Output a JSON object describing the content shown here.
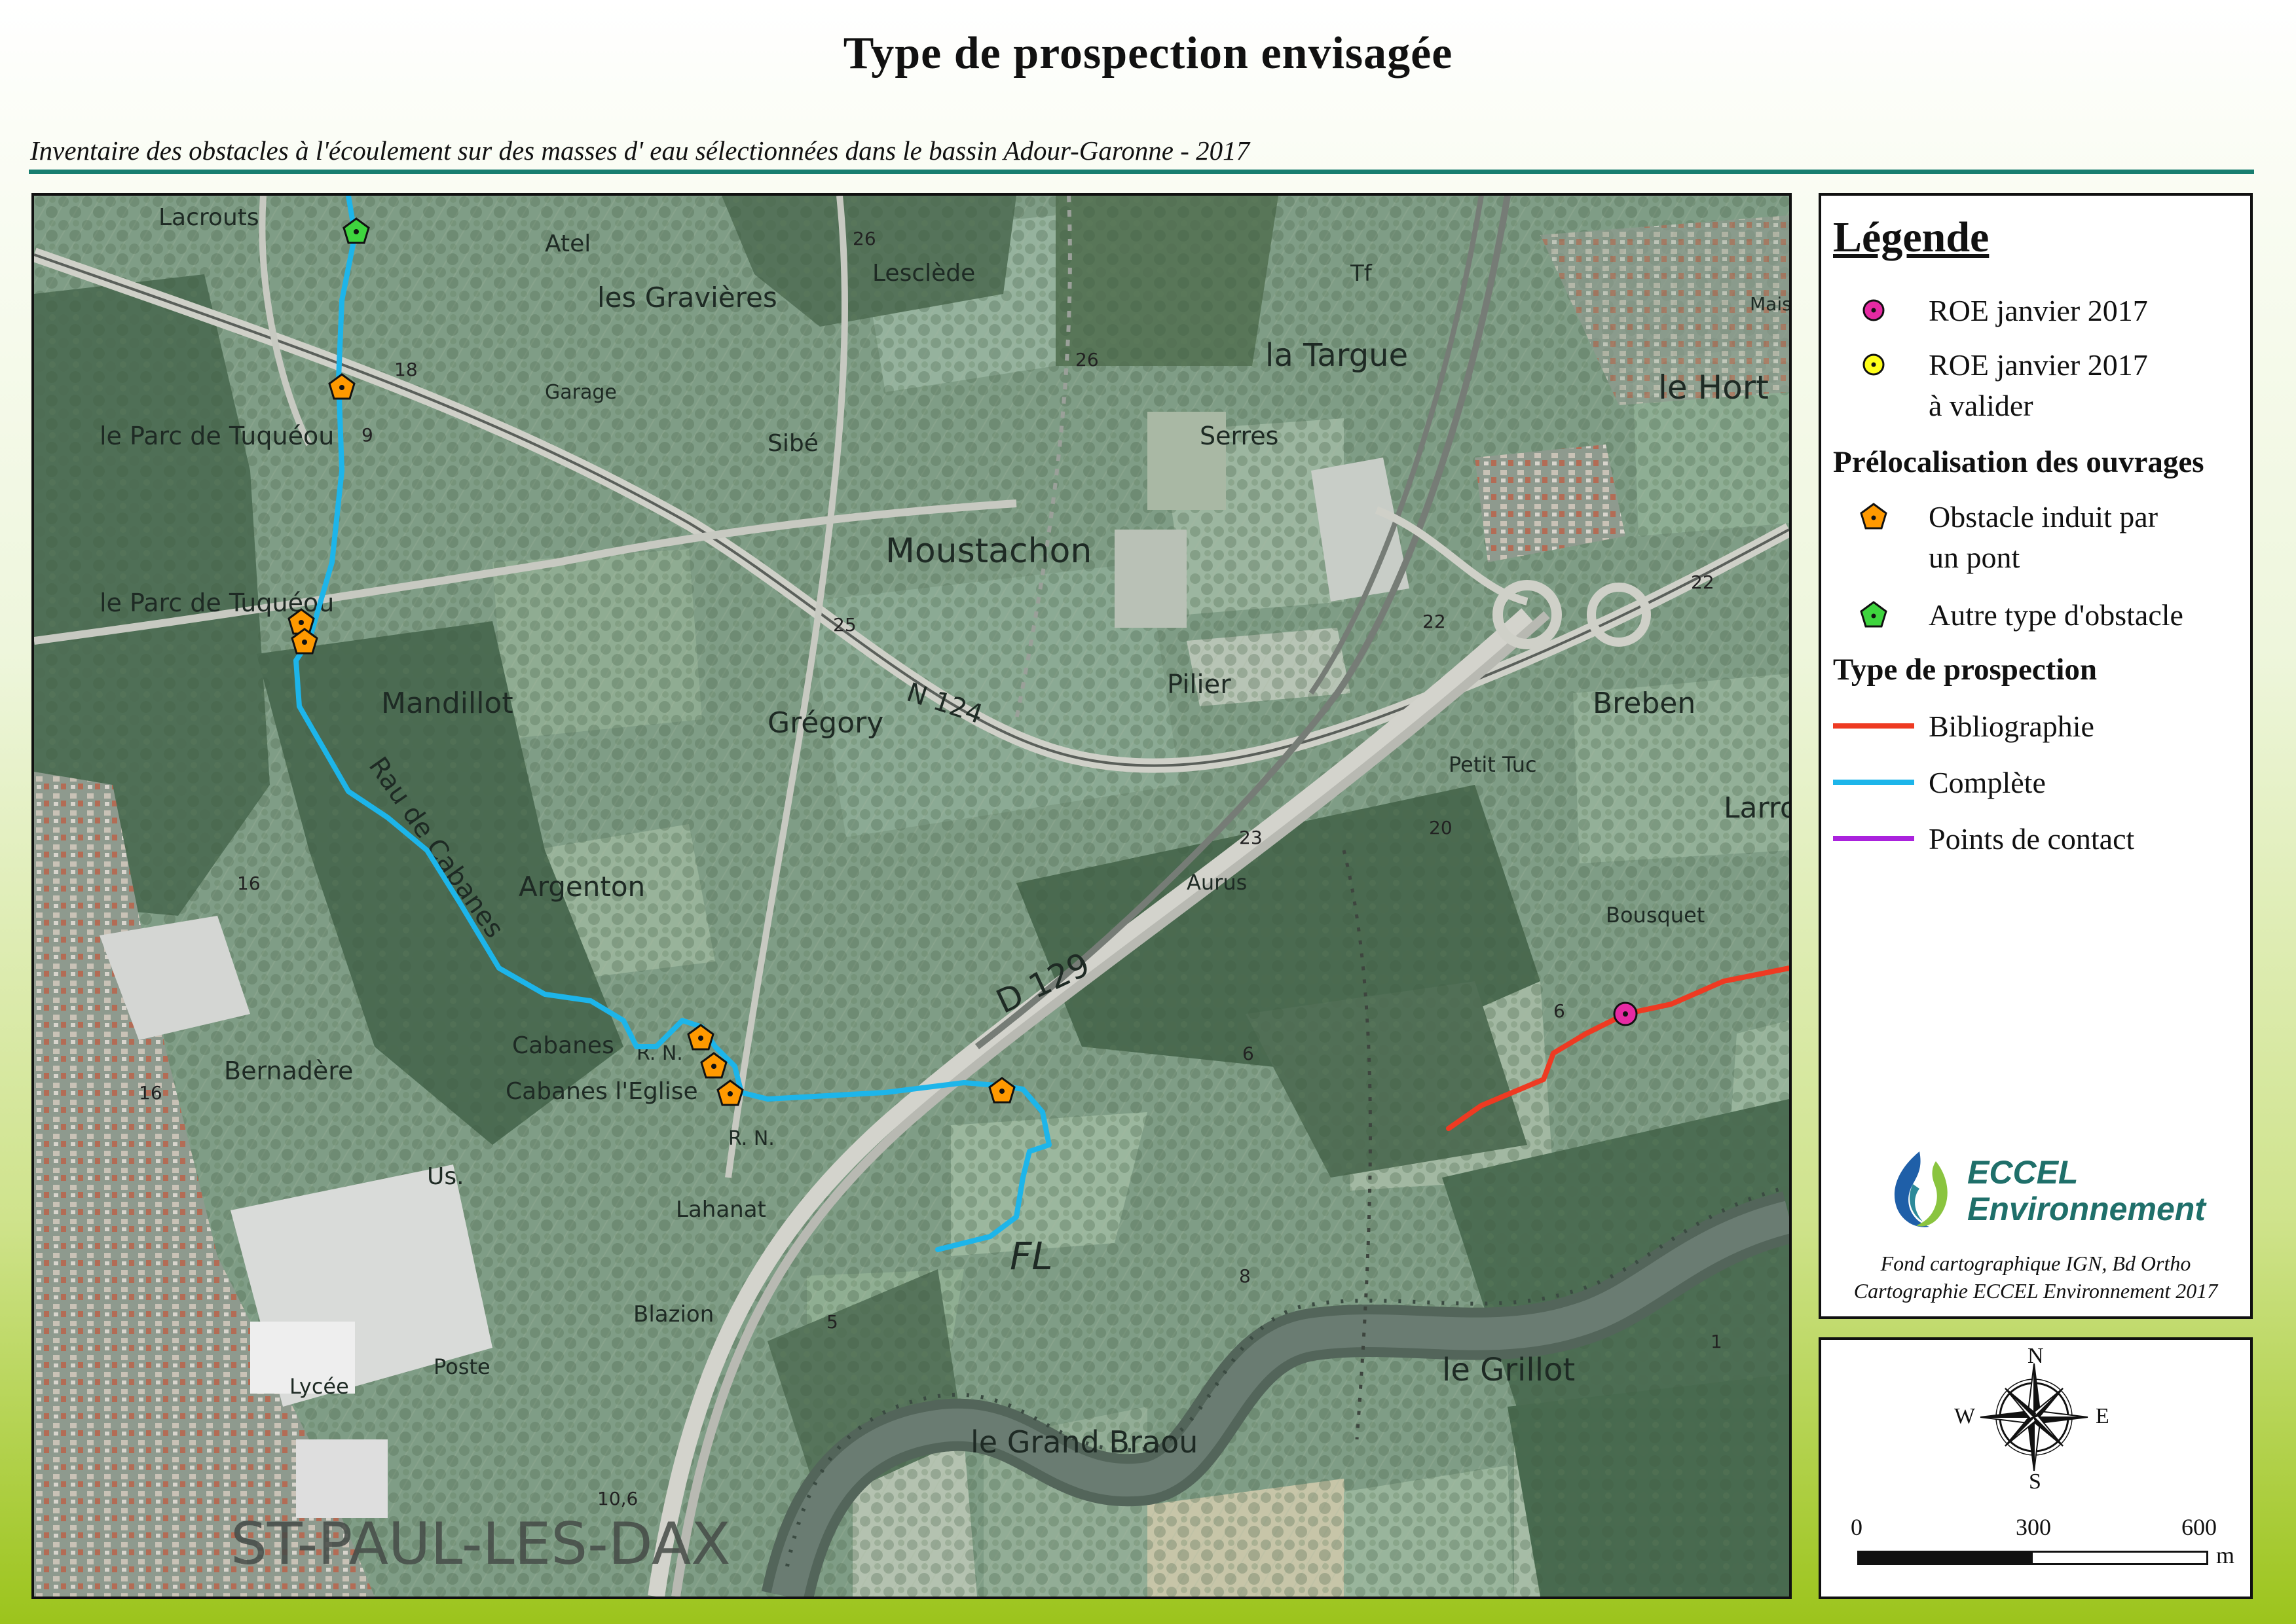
{
  "title": "Type de prospection envisagée",
  "subtitle": "Inventaire des obstacles à l'écoulement sur des masses d' eau sélectionnées dans le bassin Adour-Garonne - 2017",
  "colors": {
    "accent_rule": "#177e70",
    "roe": "#e62aa3",
    "roe_valider": "#ffff1a",
    "obstacle_pont": "#ff9900",
    "obstacle_autre": "#3ed43e",
    "bibliographie": "#ee3a22",
    "complete": "#1db5ea",
    "contact": "#aa22dd"
  },
  "map": {
    "places": [
      "Lacrouts",
      "Atel",
      "les Gravières",
      "Lesclède",
      "la Targue",
      "le Hort",
      "Mais. de retrai",
      "Garage",
      "Sibé",
      "Serres",
      "le Parc de Tuquéou",
      "le Parc de Tuquéou",
      "Moustachon",
      "Pilier",
      "Breben",
      "Mandillot",
      "Grégory",
      "Petit Tuc",
      "Larrou",
      "Argenton",
      "Aurus",
      "Bousquet",
      "Cabanes",
      "Cabanes l'Eglise",
      "Bernadère",
      "Us.",
      "Lahanat",
      "Blazion",
      "Lycée",
      "Poste",
      "le Grillot",
      "le Grand Braou",
      "ST-PAUL-LES-DAX"
    ],
    "road_labels": [
      "N 124",
      "D 129",
      "R. N.",
      "R. N.",
      "Rau de Cabanes",
      "Tf",
      "FL"
    ],
    "spot_numbers": [
      "26",
      "26",
      "18",
      "9",
      "25",
      "22",
      "22",
      "23",
      "20",
      "16",
      "16",
      "6",
      "6",
      "8",
      "5",
      "1",
      "10,6"
    ]
  },
  "legend": {
    "title": "Légende",
    "roe": "ROE janvier 2017",
    "roe_valider_1": "ROE janvier 2017",
    "roe_valider_2": "à valider",
    "section_preloc": "Prélocalisation des ouvrages",
    "pont_1": "Obstacle induit par",
    "pont_2": "un pont",
    "autre": "Autre type d'obstacle",
    "section_type": "Type de prospection",
    "biblio": "Bibliographie",
    "complete": "Complète",
    "contact": "Points de contact"
  },
  "logo": {
    "line1": "ECCEL",
    "line2": "Environnement"
  },
  "credits": {
    "line1": "Fond cartographique IGN, Bd Ortho",
    "line2": "Cartographie ECCEL Environnement 2017"
  },
  "compass": {
    "n": "N",
    "s": "S",
    "e": "E",
    "w": "W"
  },
  "scale": {
    "t0": "0",
    "t1": "300",
    "t2": "600",
    "unit": "m",
    "filled_fraction": 0.5
  }
}
